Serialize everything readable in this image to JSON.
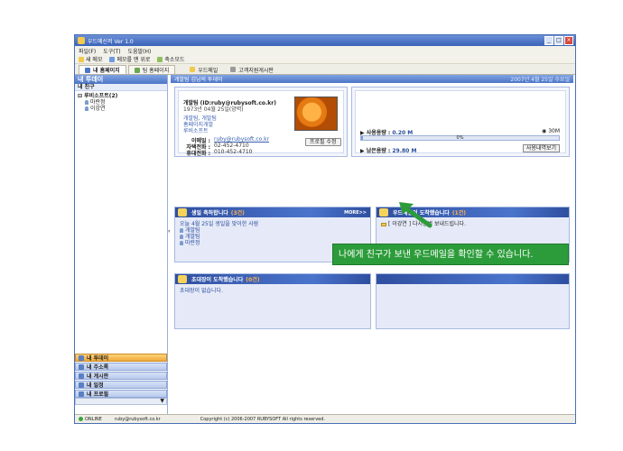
{
  "window": {
    "title": "우드메신저 Ver 1.0",
    "controls": [
      "_",
      "□",
      "×"
    ]
  },
  "menu": [
    "파일(F)",
    "도구(T)",
    "도움말(H)"
  ],
  "toolbar": [
    {
      "label": "새 메모",
      "icon": "memo-icon"
    },
    {
      "label": "메모를 맨 위로",
      "icon": "pin-icon"
    },
    {
      "label": "축소모드",
      "icon": "shrink-icon"
    }
  ],
  "tabs": [
    {
      "label": "내 홈페이지",
      "icon": "home-icon",
      "active": true
    },
    {
      "label": "팀 홈페이지",
      "icon": "team-icon",
      "active": false
    },
    {
      "label": "우드메일",
      "icon": "mail-icon",
      "active": false
    },
    {
      "label": "고객지원게시판",
      "icon": "board-icon",
      "active": false
    }
  ],
  "sidebar": {
    "title": "내 투데이",
    "section": "내 친구",
    "group": "루비소프트(2)",
    "friends": [
      "마란정",
      "이강연"
    ],
    "nav": [
      {
        "label": "내 투데이",
        "active": true
      },
      {
        "label": "내 주소록",
        "active": false
      },
      {
        "label": "내 게시판",
        "active": false
      },
      {
        "label": "내 일정",
        "active": false
      },
      {
        "label": "내 프로필",
        "active": false
      }
    ],
    "scroll_arrow": "▼"
  },
  "collapse_glyph": "‹",
  "main": {
    "header": "개발팀 김님의 투데이",
    "date": "2007년 4월 25일 수요일"
  },
  "profile": {
    "name": "개발팀 (ID:ruby@rubysoft.co.kr)",
    "birth": "1973년 04월 25일(양력)",
    "links": [
      "개발팀, 개발팀",
      "홈페이지개발",
      "루비소프트"
    ],
    "email_label": "이메일 :",
    "email": "ruby@rubysoft.co.kr",
    "phone_label": "자택전화 :",
    "phone": "02-452-4710",
    "mobile_label": "휴대전화 :",
    "mobile": "010-452-4710",
    "edit_button": "프로필 수정"
  },
  "storage": {
    "used_label": "사용용량 :",
    "used_value": "0.20 M",
    "total": "30M",
    "percent_label": "0%",
    "percent": 0.7,
    "remain_label": "남은용량 :",
    "remain_value": "29.80 M",
    "history_button": "사용내역보기"
  },
  "panels": {
    "birthday": {
      "title": "생일 축하합니다",
      "count": "(3건)",
      "more": "MORE>>",
      "intro": "오늘 4월 25일 생일을 맞이한 사람",
      "people": [
        "개발팀",
        "개발팀",
        "마란정"
      ]
    },
    "mail": {
      "title": "우드메일이 도착했습니다",
      "count": "(1건)",
      "item": "[ 이강연 ] 다시한번 보내드립니다."
    },
    "invite": {
      "title": "초대장이 도착했습니다",
      "count": "(0건)",
      "empty": "초대장이 없습니다."
    }
  },
  "status": {
    "online": "ONLINE",
    "email": "ruby@rubysoft.co.kr",
    "copyright": "Copyright (c) 2006-2007 RUBYSOFT All rights reserved."
  },
  "callout": "나에게 친구가 보낸 우드메일을 확인할 수 있습니다.",
  "colors": {
    "accent": "#4d76c6",
    "callout_green": "#2c9c3a",
    "count_orange": "#ffb24d"
  }
}
